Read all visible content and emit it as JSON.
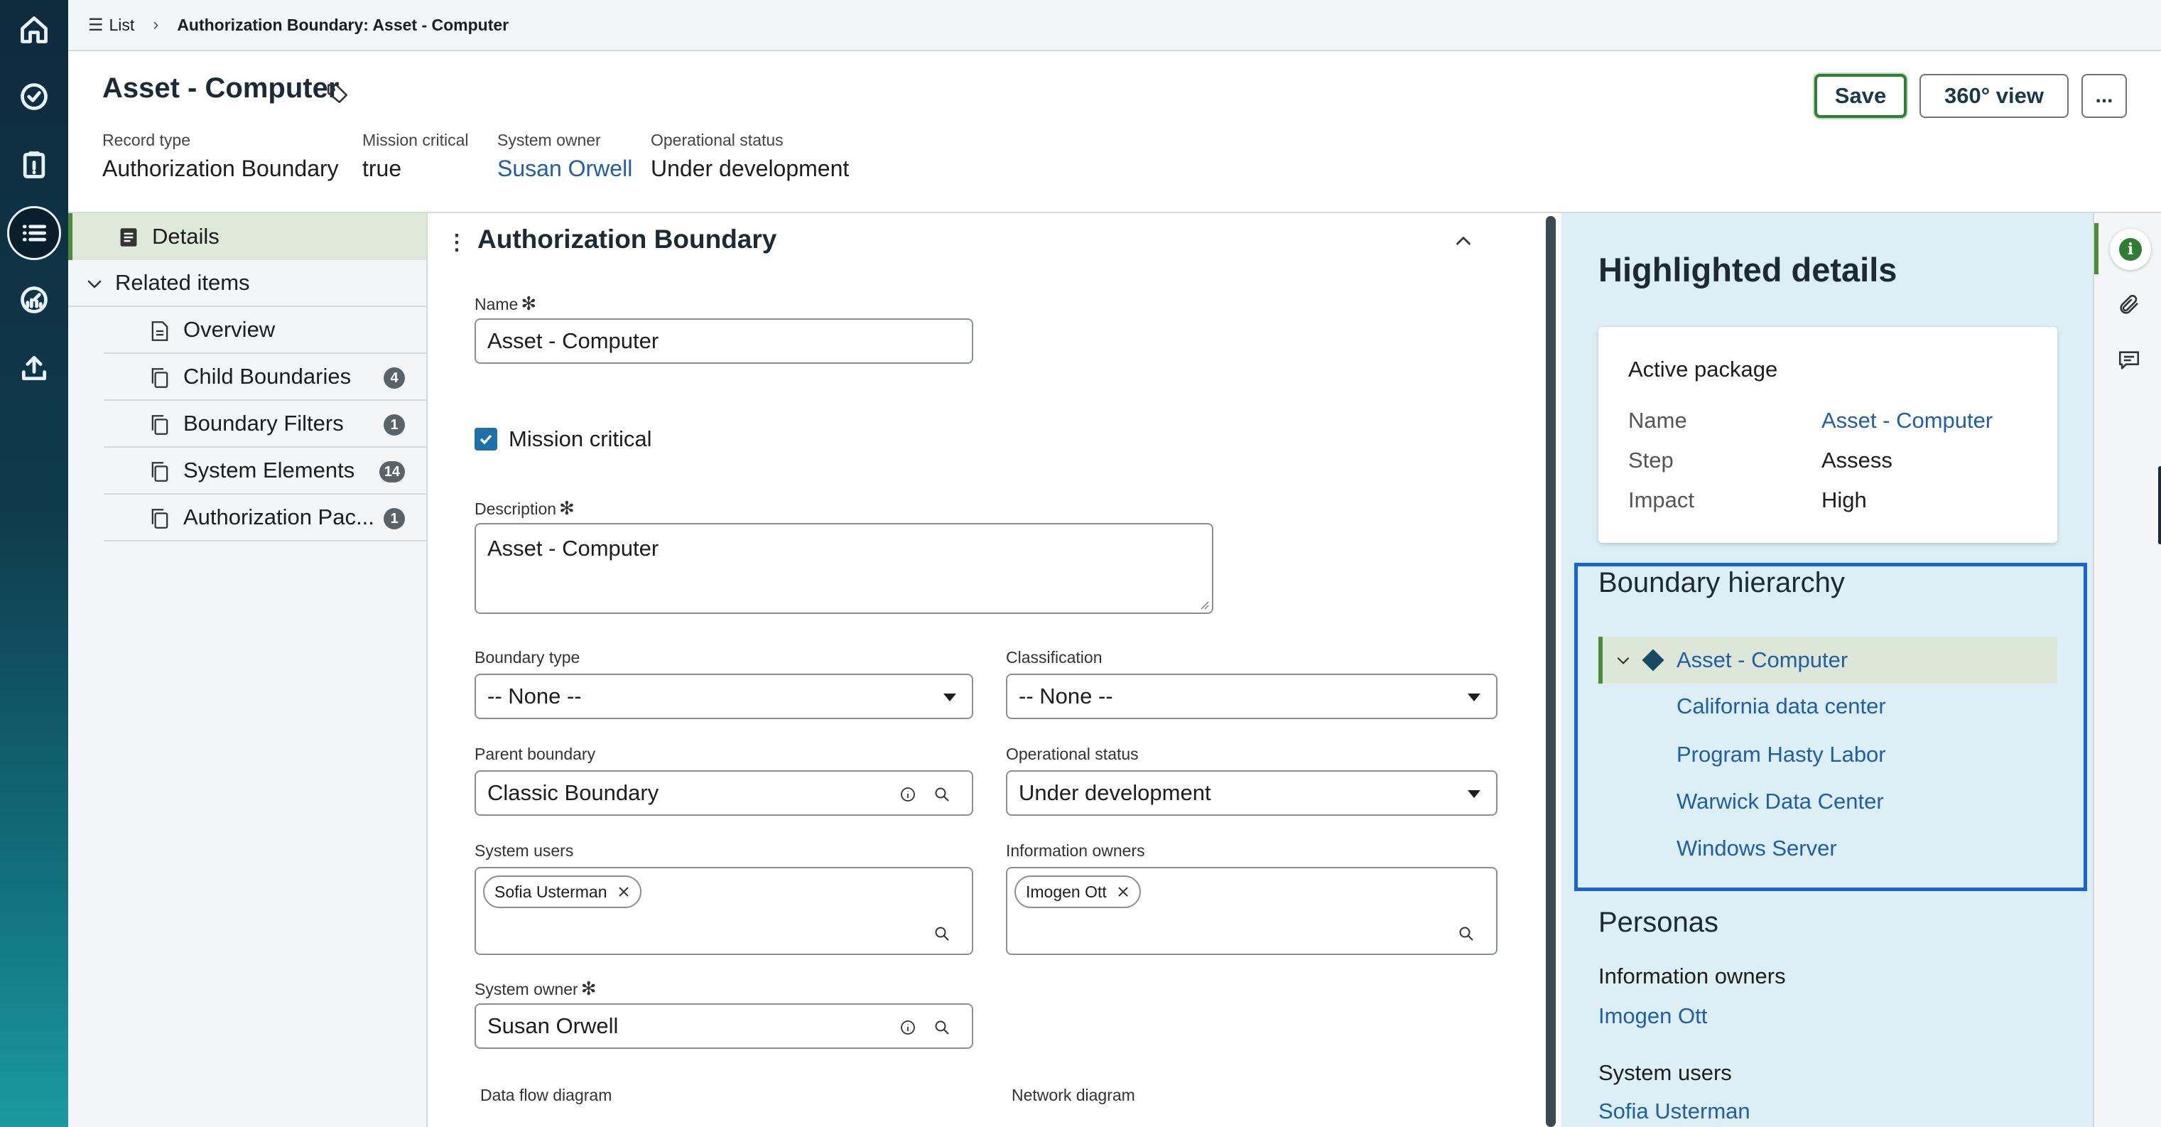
{
  "breadcrumb": {
    "list_label": "List",
    "current": "Authorization Boundary: Asset - Computer"
  },
  "header": {
    "title": "Asset - Computer",
    "meta": [
      {
        "label": "Record type",
        "value": "Authorization Boundary"
      },
      {
        "label": "Mission critical",
        "value": "true"
      },
      {
        "label": "System owner",
        "value": "Susan Orwell"
      },
      {
        "label": "Operational status",
        "value": "Under development"
      }
    ],
    "save_label": "Save",
    "view_label": "360° view",
    "more_label": "..."
  },
  "nav": {
    "details_label": "Details",
    "related_label": "Related items",
    "items": [
      {
        "label": "Overview",
        "count": ""
      },
      {
        "label": "Child Boundaries",
        "count": "4"
      },
      {
        "label": "Boundary Filters",
        "count": "1"
      },
      {
        "label": "System Elements",
        "count": "14"
      },
      {
        "label": "Authorization Pac...",
        "count": "1"
      }
    ]
  },
  "form": {
    "section_title": "Authorization Boundary",
    "name_label": "Name",
    "name_value": "Asset - Computer",
    "mission_label": "Mission critical",
    "description_label": "Description",
    "description_value": "Asset - Computer",
    "boundary_type_label": "Boundary type",
    "boundary_type_value": "-- None --",
    "classification_label": "Classification",
    "classification_value": "-- None --",
    "parent_label": "Parent boundary",
    "parent_value": "Classic Boundary",
    "op_status_label": "Operational status",
    "op_status_value": "Under development",
    "system_users_label": "System users",
    "system_users_chip": "Sofia Usterman",
    "info_owners_label": "Information owners",
    "info_owners_chip": "Imogen Ott",
    "system_owner_label": "System owner",
    "system_owner_value": "Susan Orwell",
    "data_flow_label": "Data flow diagram",
    "network_label": "Network diagram",
    "required_mark": "✻"
  },
  "panel": {
    "title": "Highlighted details",
    "package_title": "Active package",
    "package_rows": [
      {
        "label": "Name",
        "value": "Asset - Computer"
      },
      {
        "label": "Step",
        "value": "Assess"
      },
      {
        "label": "Impact",
        "value": "High"
      }
    ],
    "hierarchy_title": "Boundary hierarchy",
    "hierarchy_root": "Asset - Computer",
    "hierarchy_children": [
      "California data center",
      "Program Hasty Labor",
      "Warwick Data Center",
      "Windows Server"
    ],
    "personas_title": "Personas",
    "info_owners_label": "Information owners",
    "info_owners_value": "Imogen Ott",
    "system_users_label": "System users",
    "system_users_value": "Sofia Usterman"
  },
  "colors": {
    "rail_top": "#0e2b3c",
    "accent_green": "#2e7d32",
    "link_blue": "#1f5ea8",
    "highlight_box": "#1a62d8",
    "panel_bg": "#dceff5"
  }
}
